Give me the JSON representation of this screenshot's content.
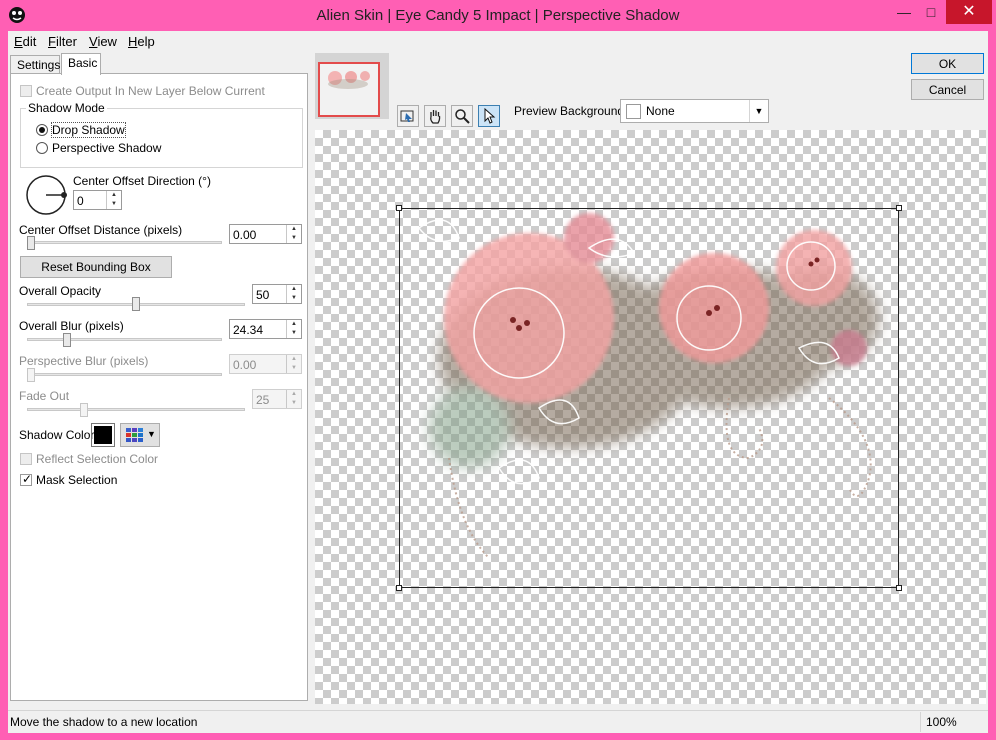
{
  "window": {
    "title": "Alien Skin | Eye Candy 5 Impact | Perspective Shadow",
    "min_glyph": "—",
    "max_glyph": "□",
    "close_glyph": "✕"
  },
  "menu": [
    {
      "label_rest": "dit",
      "accel": "E"
    },
    {
      "label_rest": "ilter",
      "accel": "F"
    },
    {
      "label_rest": "iew",
      "accel": "V"
    },
    {
      "label_rest": "elp",
      "accel": "H"
    }
  ],
  "tabs": {
    "settings": "Settings",
    "basic": "Basic"
  },
  "basic": {
    "create_output": "Create Output In New Layer Below Current",
    "shadow_mode": {
      "title": "Shadow Mode",
      "drop": "Drop Shadow",
      "perspective": "Perspective Shadow",
      "selected": "drop"
    },
    "center_offset_direction": {
      "label": "Center Offset Direction (°)",
      "value": "0"
    },
    "center_offset_distance": {
      "label": "Center Offset Distance (pixels)",
      "value": "0.00",
      "fraction": 0.0
    },
    "reset_bbox": "Reset Bounding Box",
    "overall_opacity": {
      "label": "Overall Opacity",
      "value": "50",
      "fraction": 0.5
    },
    "overall_blur": {
      "label": "Overall Blur (pixels)",
      "value": "24.34",
      "fraction": 0.19
    },
    "perspective_blur": {
      "label": "Perspective Blur (pixels)",
      "value": "0.00",
      "fraction": 0.0
    },
    "fade_out": {
      "label": "Fade Out",
      "value": "25",
      "fraction": 0.25
    },
    "shadow_color": {
      "label": "Shadow Color",
      "hex": "#000000"
    },
    "reflect_selection": "Reflect Selection Color",
    "mask_selection": "Mask Selection",
    "mask_selection_checked": true,
    "check_glyph": "✓"
  },
  "buttons": {
    "ok": "OK",
    "cancel": "Cancel"
  },
  "preview": {
    "background_label": "Preview Background:",
    "background_value": "None"
  },
  "status": {
    "text": "Move the shadow to a new location",
    "zoom": "100%"
  },
  "colors": {
    "window_border": "#ff5fb4",
    "close_button": "#c7162b",
    "thumb_frame": "#e34b4b"
  }
}
